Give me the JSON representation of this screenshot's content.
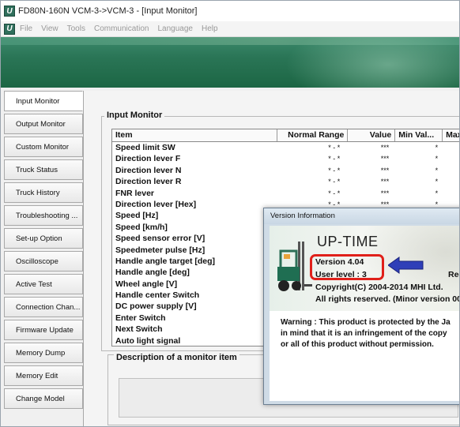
{
  "window": {
    "title": "FD80N-160N VCM-3->VCM-3 - [Input Monitor]"
  },
  "menu": [
    "File",
    "View",
    "Tools",
    "Communication",
    "Language",
    "Help"
  ],
  "nav": [
    {
      "label": "Input Monitor"
    },
    {
      "label": "Output Monitor"
    },
    {
      "label": "Custom Monitor"
    },
    {
      "label": "Truck Status"
    },
    {
      "label": "Truck History"
    },
    {
      "label": "Troubleshooting ..."
    },
    {
      "label": "Set-up Option"
    },
    {
      "label": "Oscilloscope"
    },
    {
      "label": "Active Test"
    },
    {
      "label": "Connection Chan..."
    },
    {
      "label": "Firmware Update"
    },
    {
      "label": "Memory Dump"
    },
    {
      "label": "Memory Edit"
    },
    {
      "label": "Change Model"
    }
  ],
  "input_monitor": {
    "group_label": "Input Monitor",
    "columns": {
      "item": "Item",
      "range": "Normal Range",
      "value": "Value",
      "min": "Min Val...",
      "max": "Max"
    },
    "rows": [
      {
        "item": "Speed limit SW",
        "range": "* - *",
        "value": "***",
        "min": "*"
      },
      {
        "item": "Direction lever F",
        "range": "* - *",
        "value": "***",
        "min": "*"
      },
      {
        "item": "Direction lever N",
        "range": "* - *",
        "value": "***",
        "min": "*"
      },
      {
        "item": "Direction lever R",
        "range": "* - *",
        "value": "***",
        "min": "*"
      },
      {
        "item": "FNR lever",
        "range": "* - *",
        "value": "***",
        "min": "*"
      },
      {
        "item": "Direction lever [Hex]",
        "range": "* - *",
        "value": "***",
        "min": "*"
      },
      {
        "item": "Speed [Hz]",
        "range": "",
        "value": "",
        "min": ""
      },
      {
        "item": "Speed [km/h]",
        "range": "",
        "value": "",
        "min": ""
      },
      {
        "item": "Speed sensor error [V]",
        "range": "",
        "value": "",
        "min": ""
      },
      {
        "item": "Speedmeter pulse [Hz]",
        "range": "",
        "value": "",
        "min": ""
      },
      {
        "item": "Handle angle target [deg]",
        "range": "",
        "value": "",
        "min": ""
      },
      {
        "item": "Handle angle [deg]",
        "range": "",
        "value": "",
        "min": ""
      },
      {
        "item": "Wheel angle [V]",
        "range": "",
        "value": "",
        "min": ""
      },
      {
        "item": "Handle center Switch",
        "range": "",
        "value": "",
        "min": ""
      },
      {
        "item": "DC power supply [V]",
        "range": "",
        "value": "",
        "min": ""
      },
      {
        "item": "Enter Switch",
        "range": "",
        "value": "",
        "min": ""
      },
      {
        "item": "Next Switch",
        "range": "",
        "value": "",
        "min": ""
      },
      {
        "item": "Auto light signal",
        "range": "",
        "value": "",
        "min": ""
      }
    ],
    "description_label": "Description of a monitor item"
  },
  "version_dialog": {
    "title": "Version Information",
    "product": "UP-TIME",
    "version": "Version 4.04",
    "user_level": "User level : 3",
    "regi": "Regi",
    "copyright": "Copyright(C) 2004-2014 MHI Ltd.",
    "rights": "All rights reserved. (Minor version 00",
    "warning": [
      "Warning : This product is protected by the Ja",
      "in mind that it is an infringement of the copy",
      "or all of this product without permission."
    ]
  }
}
